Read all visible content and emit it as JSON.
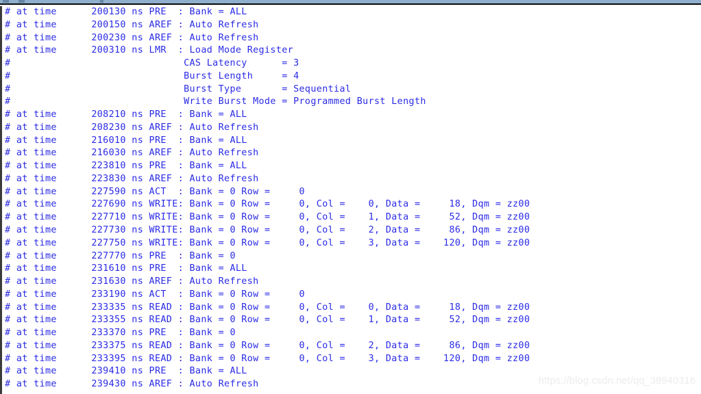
{
  "window": {
    "title": "Transcript",
    "text_color": "#2a2ae6",
    "background_color": "#ffffff",
    "toolbar_color": "#8fafcd"
  },
  "watermark": {
    "text": "https://blog.csdn.net/qq_38940316"
  },
  "transcript": {
    "lines": [
      "# at time      200130 ns PRE  : Bank = ALL",
      "# at time      200150 ns AREF : Auto Refresh",
      "# at time      200230 ns AREF : Auto Refresh",
      "# at time      200310 ns LMR  : Load Mode Register",
      "#                              CAS Latency      = 3",
      "#                              Burst Length     = 4",
      "#                              Burst Type       = Sequential",
      "#                              Write Burst Mode = Programmed Burst Length",
      "# at time      208210 ns PRE  : Bank = ALL",
      "# at time      208230 ns AREF : Auto Refresh",
      "# at time      216010 ns PRE  : Bank = ALL",
      "# at time      216030 ns AREF : Auto Refresh",
      "# at time      223810 ns PRE  : Bank = ALL",
      "# at time      223830 ns AREF : Auto Refresh",
      "# at time      227590 ns ACT  : Bank = 0 Row =     0",
      "# at time      227690 ns WRITE: Bank = 0 Row =     0, Col =    0, Data =     18, Dqm = zz00",
      "# at time      227710 ns WRITE: Bank = 0 Row =     0, Col =    1, Data =     52, Dqm = zz00",
      "# at time      227730 ns WRITE: Bank = 0 Row =     0, Col =    2, Data =     86, Dqm = zz00",
      "# at time      227750 ns WRITE: Bank = 0 Row =     0, Col =    3, Data =    120, Dqm = zz00",
      "# at time      227770 ns PRE  : Bank = 0",
      "# at time      231610 ns PRE  : Bank = ALL",
      "# at time      231630 ns AREF : Auto Refresh",
      "# at time      233190 ns ACT  : Bank = 0 Row =     0",
      "# at time      233335 ns READ : Bank = 0 Row =     0, Col =    0, Data =     18, Dqm = zz00",
      "# at time      233355 ns READ : Bank = 0 Row =     0, Col =    1, Data =     52, Dqm = zz00",
      "# at time      233370 ns PRE  : Bank = 0",
      "# at time      233375 ns READ : Bank = 0 Row =     0, Col =    2, Data =     86, Dqm = zz00",
      "# at time      233395 ns READ : Bank = 0 Row =     0, Col =    3, Data =    120, Dqm = zz00",
      "# at time      239410 ns PRE  : Bank = ALL",
      "# at time      239430 ns AREF : Auto Refresh"
    ]
  }
}
